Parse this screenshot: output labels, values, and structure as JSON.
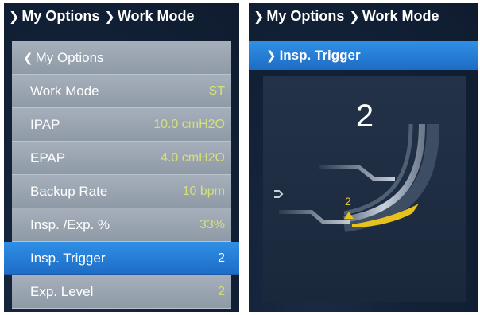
{
  "left_screen": {
    "breadcrumb": [
      "My Options",
      "Work Mode"
    ],
    "back_label": "My Options",
    "rows": [
      {
        "label": "Work Mode",
        "value": "ST"
      },
      {
        "label": "IPAP",
        "value": "10.0 cmH2O"
      },
      {
        "label": "EPAP",
        "value": "4.0 cmH2O"
      },
      {
        "label": "Backup Rate",
        "value": "10 bpm"
      },
      {
        "label": "Insp. /Exp. %",
        "value": "33%"
      },
      {
        "label": "Insp. Trigger",
        "value": "2"
      },
      {
        "label": "Exp. Level",
        "value": "2"
      }
    ],
    "selected_row": "Insp. Trigger"
  },
  "right_screen": {
    "breadcrumb": [
      "My Options",
      "Work Mode"
    ],
    "selected_label": "Insp. Trigger",
    "trigger_value": "2",
    "marker_label": "2"
  },
  "colors": {
    "selection": "#1e6cc4",
    "value_text": "#d6e07a",
    "marker": "#e8c21c",
    "background": "#132238"
  },
  "icons": [
    "chevron-right-icon",
    "chevron-left-icon",
    "trigger-arc-diagram",
    "breath-input-icon"
  ]
}
